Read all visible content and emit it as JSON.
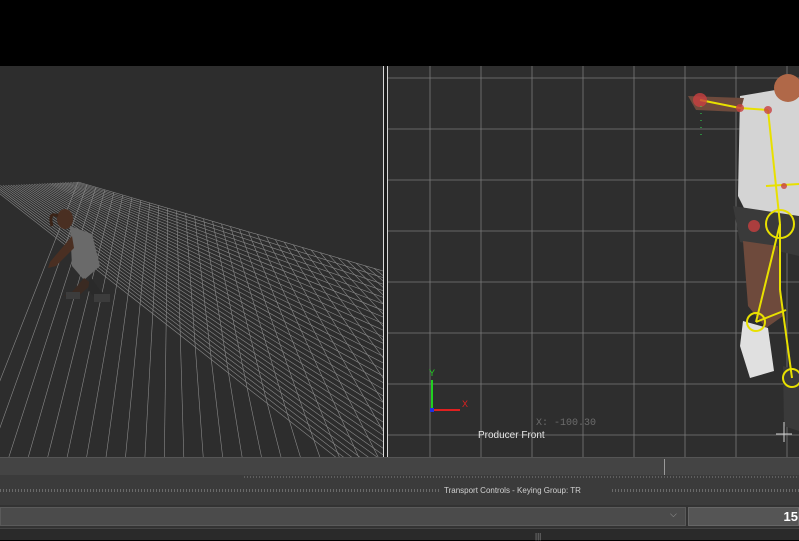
{
  "viewports": {
    "right": {
      "label": "Producer Front",
      "coord_readout": "X: -100.30",
      "axis_y_label": "Y",
      "axis_x_label": "X"
    }
  },
  "transport": {
    "title": "Transport Controls  -  Keying Group: TR"
  },
  "combo": {
    "arrow_icon": "chevron-down-icon",
    "field_value": "15"
  },
  "colors": {
    "bone": "#e8e000",
    "joint_marker": "#c84040",
    "axis_y": "#20d020",
    "axis_x": "#e02020"
  }
}
